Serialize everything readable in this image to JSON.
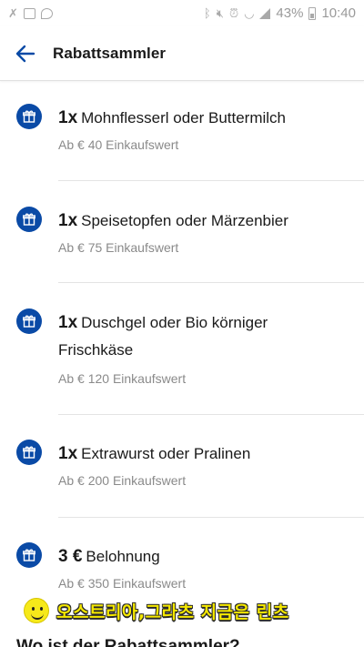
{
  "status_bar": {
    "battery_percent": "43%",
    "time": "10:40"
  },
  "app_bar": {
    "title": "Rabattsammler"
  },
  "rewards": [
    {
      "qty": "1x",
      "name": "Mohnflesserl oder Buttermilch",
      "threshold": "Ab € 40 Einkaufswert"
    },
    {
      "qty": "1x",
      "name": "Speisetopfen oder Märzenbier",
      "threshold": "Ab € 75 Einkaufswert"
    },
    {
      "qty": "1x",
      "name": "Duschgel oder Bio körniger Frischkäse",
      "threshold": "Ab € 120 Einkaufswert"
    },
    {
      "qty": "1x",
      "name": "Extrawurst oder Pralinen",
      "threshold": "Ab € 200 Einkaufswert"
    },
    {
      "qty": "3 €",
      "name": "Belohnung",
      "threshold": "Ab € 350 Einkaufswert"
    }
  ],
  "overlay_banner": {
    "text": "오스트리아,그라츠 지금은 린츠"
  },
  "section": {
    "heading": "Wo ist der Rabattsammler?"
  },
  "colors": {
    "accent": "#0a4aa6",
    "banner_yellow": "#f5e800"
  }
}
